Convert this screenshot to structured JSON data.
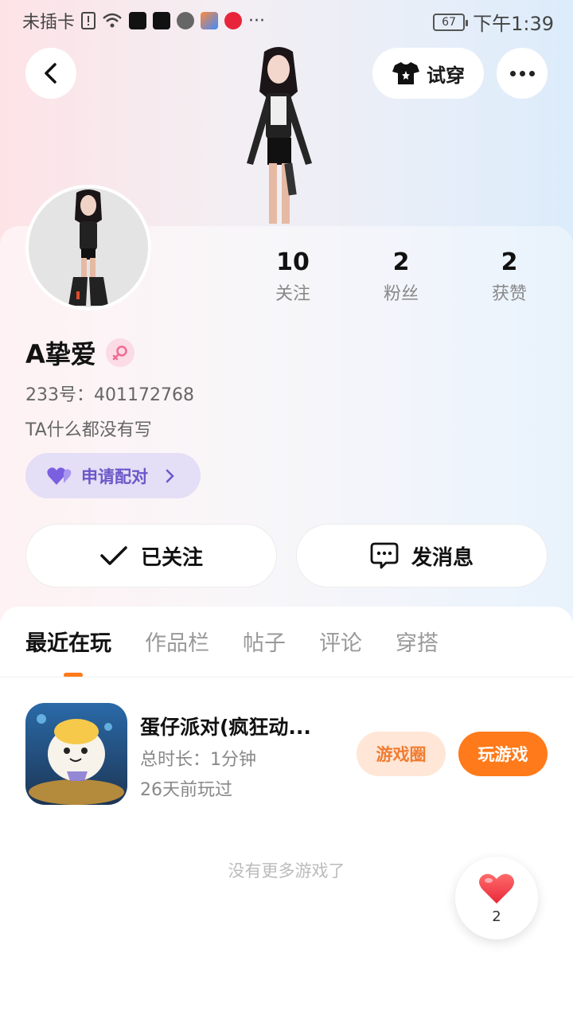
{
  "status_bar": {
    "carrier": "未插卡",
    "battery": "67",
    "time": "下午1:39",
    "more": "···"
  },
  "header": {
    "tryon_label": "试穿"
  },
  "profile": {
    "stats": [
      {
        "num": "10",
        "label": "关注"
      },
      {
        "num": "2",
        "label": "粉丝"
      },
      {
        "num": "2",
        "label": "获赞"
      }
    ],
    "name": "A挚爱",
    "id_line": "233号：401172768",
    "bio": "TA什么都没有写",
    "pair_label": "申请配对",
    "follow_label": "已关注",
    "message_label": "发消息"
  },
  "tabs": [
    "最近在玩",
    "作品栏",
    "帖子",
    "评论",
    "穿搭"
  ],
  "game": {
    "title": "蛋仔派对(疯狂动...",
    "duration": "总时长：1分钟",
    "last_played": "26天前玩过",
    "circle_label": "游戏圈",
    "play_label": "玩游戏"
  },
  "no_more": "没有更多游戏了",
  "like": {
    "count": "2"
  },
  "colors": {
    "accent_orange": "#ff7a1a",
    "pair_purple": "#6b58c8",
    "heart_red": "#f03a45"
  }
}
